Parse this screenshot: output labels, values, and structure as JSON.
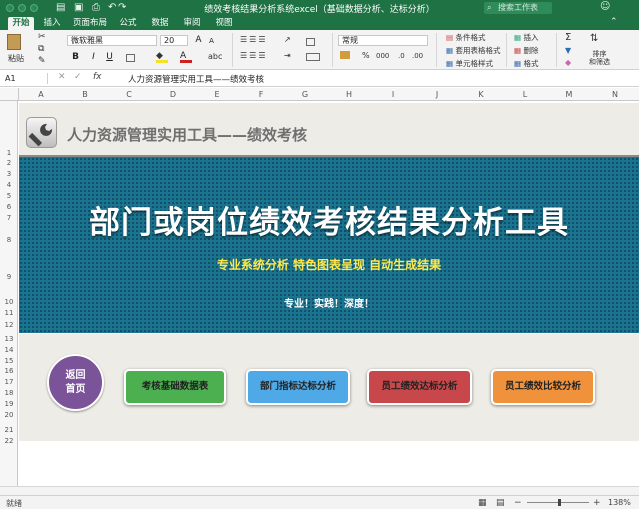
{
  "window": {
    "title": "绩效考核结果分析系统excel（基础数据分析、达标分析）",
    "search_placeholder": "搜索工作表"
  },
  "tabs": [
    "开始",
    "插入",
    "页面布局",
    "公式",
    "数据",
    "审阅",
    "视图"
  ],
  "ribbon": {
    "paste_label": "粘贴",
    "font_name": "微软雅黑",
    "font_size": "20",
    "number_format": "常规",
    "conditional_format": "条件格式",
    "table_format": "套用表格格式",
    "cell_style": "单元格样式",
    "insert": "插入",
    "delete": "删除",
    "format": "格式",
    "sort_filter": "排序\n和筛选",
    "bold": "B",
    "italic": "I",
    "underline": "U",
    "percent": "%",
    "comma": "000"
  },
  "formula_bar": {
    "name_box": "A1",
    "fx": "fx",
    "content": "人力资源管理实用工具——绩效考核"
  },
  "columns": [
    "A",
    "B",
    "C",
    "D",
    "E",
    "F",
    "G",
    "H",
    "I",
    "J",
    "K",
    "L",
    "M",
    "N"
  ],
  "rows": [
    "1",
    "2",
    "3",
    "4",
    "5",
    "6",
    "7",
    "8",
    "9",
    "10",
    "11",
    "12",
    "13",
    "14",
    "15",
    "16",
    "17",
    "18",
    "19",
    "20",
    "21",
    "22"
  ],
  "sheet": {
    "header_title": "人力资源管理实用工具——绩效考核",
    "main_title": "部门或岗位绩效考核结果分析工具",
    "subtitle": "专业系统分析  特色图表呈现  自动生成结果",
    "slogan": "专业！实践！深度！",
    "home_button": "返回\n首页",
    "nav_buttons": [
      {
        "label": "考核基础数据表",
        "color": "#4caf50"
      },
      {
        "label": "部门指标达标分析",
        "color": "#4fa9e6"
      },
      {
        "label": "员工绩效达标分析",
        "color": "#c8474a"
      },
      {
        "label": "员工绩效比较分析",
        "color": "#f0923c"
      }
    ]
  },
  "status": {
    "ready": "就绪",
    "zoom": "138%"
  }
}
